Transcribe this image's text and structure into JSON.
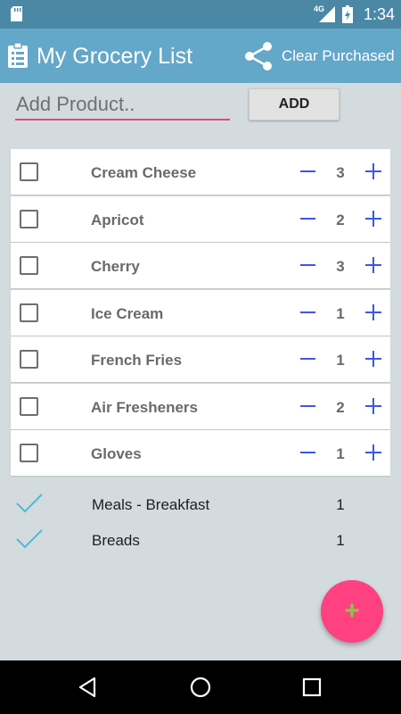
{
  "status_bar": {
    "network": "4G",
    "time": "1:34",
    "icons": [
      "sd-card-icon",
      "signal-icon",
      "battery-charging-icon"
    ]
  },
  "app_bar": {
    "title": "My Grocery List",
    "clear_label": "Clear Purchased",
    "icons": [
      "clipboard-list-icon",
      "share-icon"
    ]
  },
  "add_product": {
    "placeholder": "Add Product..",
    "value": "",
    "button_label": "ADD"
  },
  "items": [
    {
      "name": "Cream Cheese",
      "qty": "3",
      "checked": false
    },
    {
      "name": "Apricot",
      "qty": "2",
      "checked": false
    },
    {
      "name": "Cherry",
      "qty": "3",
      "checked": false
    },
    {
      "name": "Ice Cream",
      "qty": "1",
      "checked": false
    },
    {
      "name": "French Fries",
      "qty": "1",
      "checked": false
    },
    {
      "name": "Air Fresheners",
      "qty": "2",
      "checked": false
    },
    {
      "name": "Gloves",
      "qty": "1",
      "checked": false
    }
  ],
  "purchased": [
    {
      "name": "Meals - Breakfast",
      "qty": "1"
    },
    {
      "name": "Breads",
      "qty": "1"
    }
  ],
  "fab": {
    "symbol": "+"
  },
  "colors": {
    "status_bar": "#4a88a6",
    "app_bar": "#63a7c9",
    "accent": "#ff4081",
    "stepper": "#3d57e0",
    "check": "#4fb8d8",
    "fab_symbol": "#8bc34a"
  }
}
